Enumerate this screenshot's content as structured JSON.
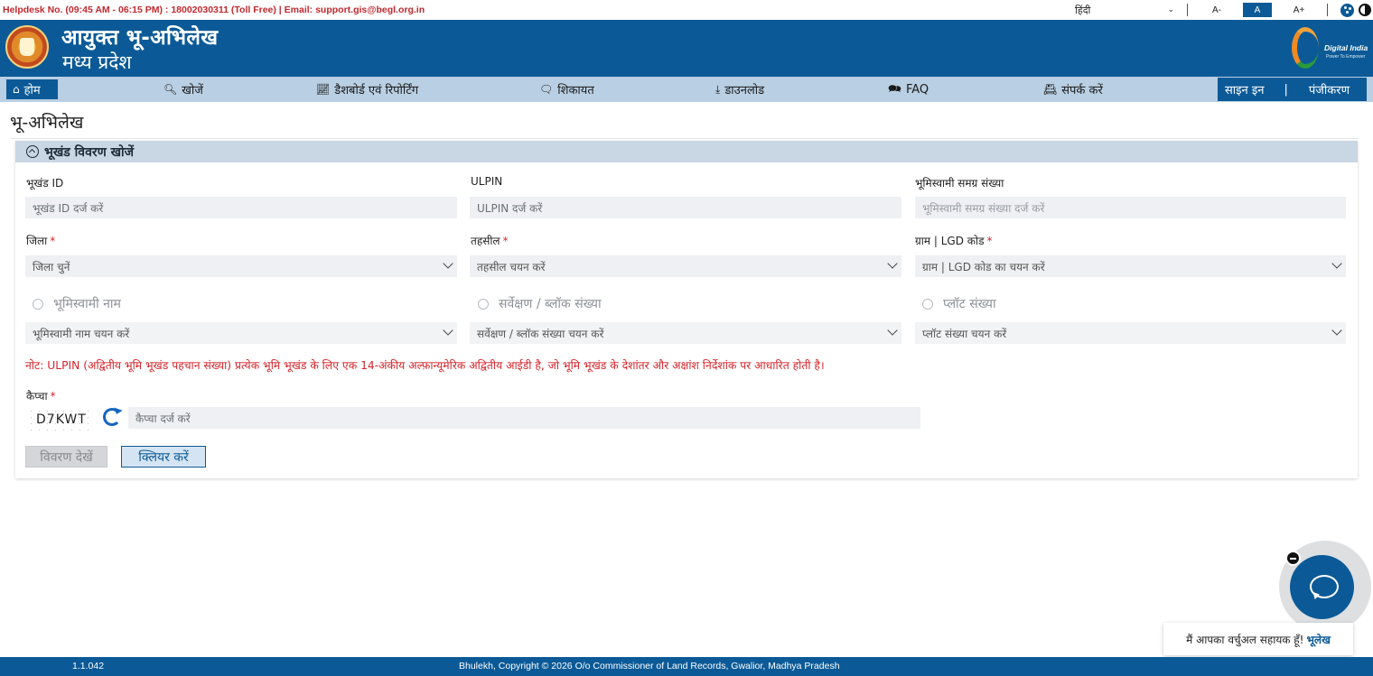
{
  "topbar": {
    "helpdesk": "Helpdesk No. (09:45 AM - 06:15 PM) : 18002030311 (Toll Free) | Email: support.gis@begl.org.in",
    "language": "हिंदी",
    "font_decrease": "A-",
    "font_normal": "A",
    "font_increase": "A+"
  },
  "header": {
    "title": "आयुक्त भू-अभिलेख",
    "subtitle": "मध्य प्रदेश",
    "partner_logo_text": "Digital India",
    "partner_logo_tagline": "Power To Empower"
  },
  "nav": {
    "home": "होम",
    "search": "खोजें",
    "dashboard": "डैशबोर्ड एवं रिपोर्टिंग",
    "complaint": "शिकायत",
    "download": "डाउनलोड",
    "faq": "FAQ",
    "contact": "संपर्क करें",
    "signin": "साइन इन",
    "separator": "|",
    "register": "पंजीकरण"
  },
  "page": {
    "title": "भू-अभिलेख"
  },
  "form": {
    "section_title": "भूखंड विवरण खोजें",
    "plot_id": {
      "label": "भूखंड ID",
      "placeholder": "भूखंड ID दर्ज करें"
    },
    "ulpin": {
      "label": "ULPIN",
      "placeholder": "ULPIN दर्ज करें"
    },
    "samagra": {
      "label": "भूमिस्वामी समग्र संख्या",
      "placeholder": "भूमिस्वामी समग्र संख्या दर्ज करें"
    },
    "district": {
      "label": "जिला",
      "placeholder": "जिला चुनें"
    },
    "tehsil": {
      "label": "तहसील",
      "placeholder": "तहसील चयन करें"
    },
    "village": {
      "label": "ग्राम | LGD कोड",
      "placeholder": "ग्राम | LGD कोड का चयन करें"
    },
    "owner_name": {
      "label": "भूमिस्वामी नाम",
      "placeholder": "भूमिस्वामी नाम चयन करें"
    },
    "survey_no": {
      "label": "सर्वेक्षण / ब्लॉक संख्या",
      "placeholder": "सर्वेक्षण / ब्लॉक संख्या चयन करें"
    },
    "plot_no": {
      "label": "प्लॉट संख्या",
      "placeholder": "प्लॉट संख्या चयन करें"
    },
    "required_mark": "*",
    "note": "नोट: ULPIN (अद्वितीय भूमि भूखंड पहचान संख्या) प्रत्येक भूमि भूखंड के लिए एक 14-अंकीय अल्फ़ान्यूमेरिक अद्वितीय आईडी है, जो भूमि भूखंड के देशांतर और अक्षांश निर्देशांक पर आधारित होती है।",
    "captcha": {
      "label": "कैप्चा",
      "code": "D7KWT",
      "placeholder": "कैप्चा दर्ज करें"
    },
    "view_button": "विवरण देखें",
    "clear_button": "क्लियर करें"
  },
  "chat": {
    "tooltip": "मैं आपका वर्चुअल सहायक हूँ!",
    "brand": "भूलेख"
  },
  "footer": {
    "version": "1.1.042",
    "copyright": "Bhulekh, Copyright © 2026 O/o Commissioner of Land Records, Gwalior, Madhya Pradesh"
  }
}
